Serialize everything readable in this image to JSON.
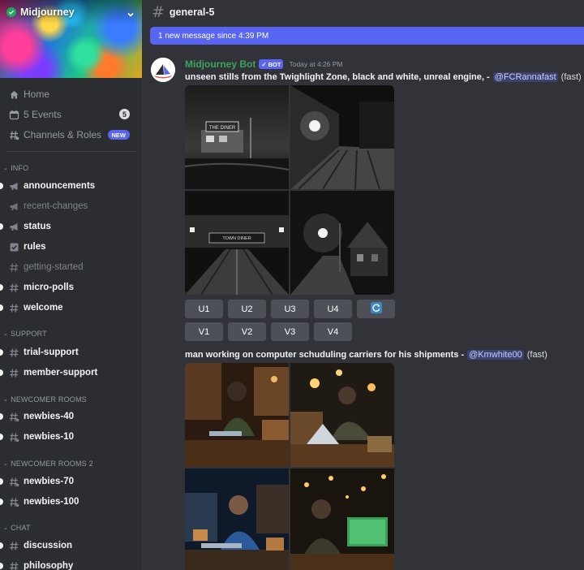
{
  "server": {
    "name": "Midjourney"
  },
  "nav": {
    "home": "Home",
    "events": "5 Events",
    "events_count": "5",
    "channels_roles": "Channels & Roles",
    "new_badge": "NEW"
  },
  "categories": {
    "info": "INFO",
    "support": "SUPPORT",
    "newcomer": "NEWCOMER ROOMS",
    "newcomer2": "NEWCOMER ROOMS 2",
    "chat": "CHAT"
  },
  "channels": {
    "announcements": "announcements",
    "recent_changes": "recent-changes",
    "status": "status",
    "rules": "rules",
    "getting_started": "getting-started",
    "micro_polls": "micro-polls",
    "welcome": "welcome",
    "trial_support": "trial-support",
    "member_support": "member-support",
    "newbies_40": "newbies-40",
    "newbies_10": "newbies-10",
    "newbies_70": "newbies-70",
    "newbies_100": "newbies-100",
    "discussion": "discussion",
    "philosophy": "philosophy"
  },
  "channel_header": {
    "title": "general-5"
  },
  "new_messages": "1 new message since 4:39 PM",
  "message": {
    "author": "Midjourney Bot",
    "bot_tag": "BOT",
    "timestamp": "Today at 4:26 PM"
  },
  "post1": {
    "prompt": "unseen stills from the Twighlight Zone, black and white, unreal engine, -",
    "mention": "@FCRannafast",
    "speed": "(fast)",
    "sign_text_1": "THE DINER",
    "sign_text_3": "TOWN DINER"
  },
  "buttons": {
    "u1": "U1",
    "u2": "U2",
    "u3": "U3",
    "u4": "U4",
    "v1": "V1",
    "v2": "V2",
    "v3": "V3",
    "v4": "V4",
    "reroll_icon": "refresh-icon"
  },
  "post2": {
    "prompt": "man working on computer schuduling carriers for his shipments -",
    "mention": "@Kmwhite00",
    "speed": "(fast)"
  },
  "colors": {
    "accent": "#5865f2",
    "bot_name": "#3ba55d",
    "sidebar_bg": "#2b2d31",
    "main_bg": "#313338"
  }
}
